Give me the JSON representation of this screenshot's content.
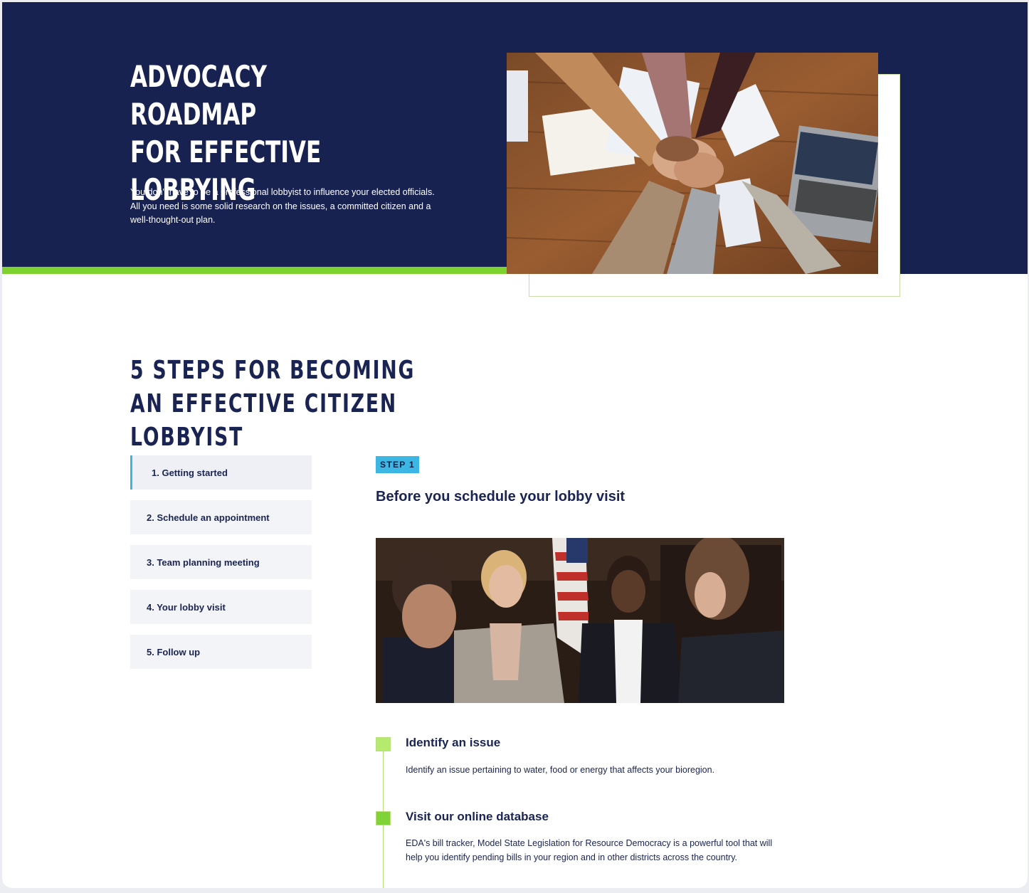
{
  "hero": {
    "title": "ADVOCACY ROADMAP\nFOR EFFECTIVE\nLOBBYING",
    "description": "You don't have to be a professional lobbyist to influence your elected officials. All you need is some solid research on the issues, a committed citizen and a well-thought-out plan.",
    "image": "hands-stacked-on-table-photo"
  },
  "steps_section": {
    "title": "5 STEPS FOR BECOMING\nAN EFFECTIVE CITIZEN LOBBYIST",
    "tabs": [
      {
        "label": "1. Getting started",
        "active": true
      },
      {
        "label": "2. Schedule an appointment",
        "active": false
      },
      {
        "label": "3. Team planning meeting",
        "active": false
      },
      {
        "label": "4. Your lobby visit",
        "active": false
      },
      {
        "label": "5. Follow up",
        "active": false
      }
    ]
  },
  "step_content": {
    "badge": "STEP 1",
    "heading": "Before you schedule your lobby visit",
    "image": "four-people-meeting-with-flag-photo",
    "items": [
      {
        "title": "Identify an issue",
        "text": "Identify an issue pertaining to water, food or energy that affects your bioregion."
      },
      {
        "title": "Visit our online database",
        "text": "EDA's bill tracker, Model State Legislation for Resource Democracy is a powerful tool that will help you identify pending bills in your region and in other districts across the country."
      }
    ]
  },
  "colors": {
    "navy": "#182251",
    "green_accent": "#7ed22f",
    "blue_accent": "#3cb6e3",
    "text": "#1a2452"
  }
}
